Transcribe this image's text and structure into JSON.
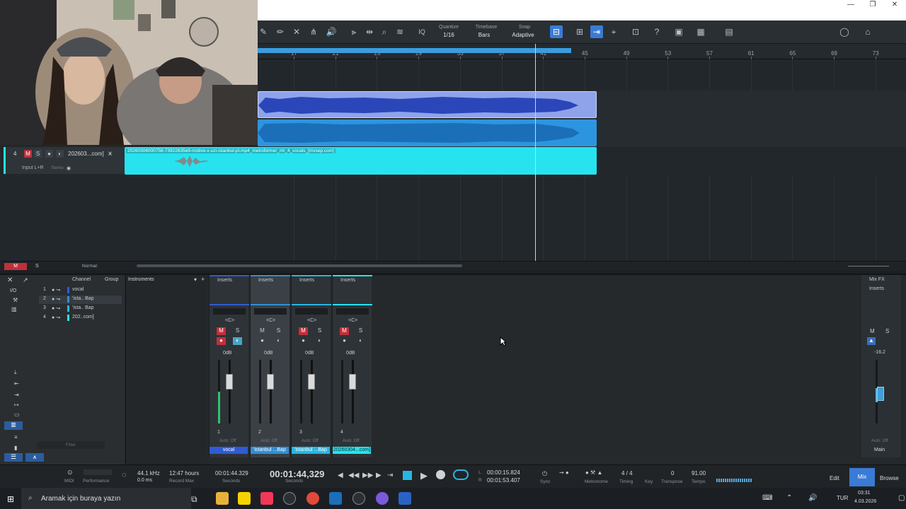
{
  "window": {
    "minimize": "—",
    "restore": "❐",
    "close": "✕"
  },
  "toolbar": {
    "quantize_label": "Quantize",
    "quantize_value": "1/16",
    "timebase_label": "Timebase",
    "timebase_value": "Bars",
    "snap_label": "Snap",
    "snap_value": "Adaptive",
    "iq": "IQ"
  },
  "ruler": {
    "bars": [
      "17",
      "21",
      "25",
      "29",
      "33",
      "37",
      "41",
      "45",
      "49",
      "53",
      "57",
      "61",
      "65",
      "69",
      "73"
    ]
  },
  "track4": {
    "number": "4",
    "mute": "M",
    "solo": "S",
    "name": "202603...com]",
    "input": "Input L+R",
    "stereo": "Stereo",
    "clip_name": "20260304000758-73922635e9-motive-x-uzi-istanbul-pt.mp4_melroformer_mt_4_vocals_[mvsep.com]"
  },
  "arrange_bottom": {
    "mute": "M",
    "solo": "S",
    "mode": "Normal"
  },
  "channel_list": {
    "header_channel": "Channel",
    "header_group": "Group",
    "io": "I/O",
    "items": [
      {
        "num": "1",
        "name": "vocal",
        "color": "#2f5bd6"
      },
      {
        "num": "2",
        "name": "'ista.. Bap",
        "color": "#2f8fd6"
      },
      {
        "num": "3",
        "name": "'ista.. Bap",
        "color": "#27b6e3"
      },
      {
        "num": "4",
        "name": "202..com]",
        "color": "#27e3ef"
      }
    ],
    "filter": "Filter"
  },
  "instruments": {
    "label": "Instruments"
  },
  "strips": [
    {
      "inserts": "Inserts",
      "pan": "<C>",
      "mute": "M",
      "solo": "S",
      "gain": "0dB",
      "num": "1",
      "auto": "Auto: Off",
      "name": "vocal",
      "color": "#2f5bd6"
    },
    {
      "inserts": "Inserts",
      "pan": "<C>",
      "mute": "M",
      "solo": "S",
      "gain": "0dB",
      "num": "2",
      "auto": "Auto: Off",
      "name": "'istanbul ...Bap",
      "color": "#2f8fd6"
    },
    {
      "inserts": "Inserts",
      "pan": "<C>",
      "mute": "M",
      "solo": "S",
      "gain": "0dB",
      "num": "3",
      "auto": "Auto: Off",
      "name": "'istanbul ...Bap",
      "color": "#27b6e3"
    },
    {
      "inserts": "Inserts",
      "pan": "<C>",
      "mute": "M",
      "solo": "S",
      "gain": "0dB",
      "num": "4",
      "auto": "Auto: Off",
      "name": "20260304...com]",
      "color": "#27e3ef"
    }
  ],
  "main": {
    "mixfx": "Mix FX",
    "inserts": "Inserts",
    "mute": "M",
    "solo": "S",
    "level": "-16.2",
    "auto": "Auto: Off",
    "name": "Main"
  },
  "transport": {
    "midi": "MIDI",
    "performance": "Performance",
    "sample_rate": "44.1 kHz",
    "latency": "0.0 ms",
    "record_time": "12:47 hours",
    "record_label": "Record Max",
    "seconds1": "00:01:44.329",
    "seconds1_label": "Seconds",
    "main_time": "00:01:44,329",
    "main_label": "Seconds",
    "l_time": "00:00:15.824",
    "r_time": "00:01:53.407",
    "l": "L",
    "r": "R",
    "sync": "Sync",
    "metronome": "Metronome",
    "timing_value": "4 / 4",
    "timing": "Timing",
    "key": "Key",
    "transpose_value": "0",
    "transpose": "Transpose",
    "tempo_value": "91.00",
    "tempo": "Tempo",
    "edit": "Edit",
    "mix": "Mix",
    "browse": "Browse"
  },
  "taskbar": {
    "search": "Aramak için buraya yazın",
    "lang": "TUR",
    "time": "03:31",
    "date": "4.03.2026"
  }
}
